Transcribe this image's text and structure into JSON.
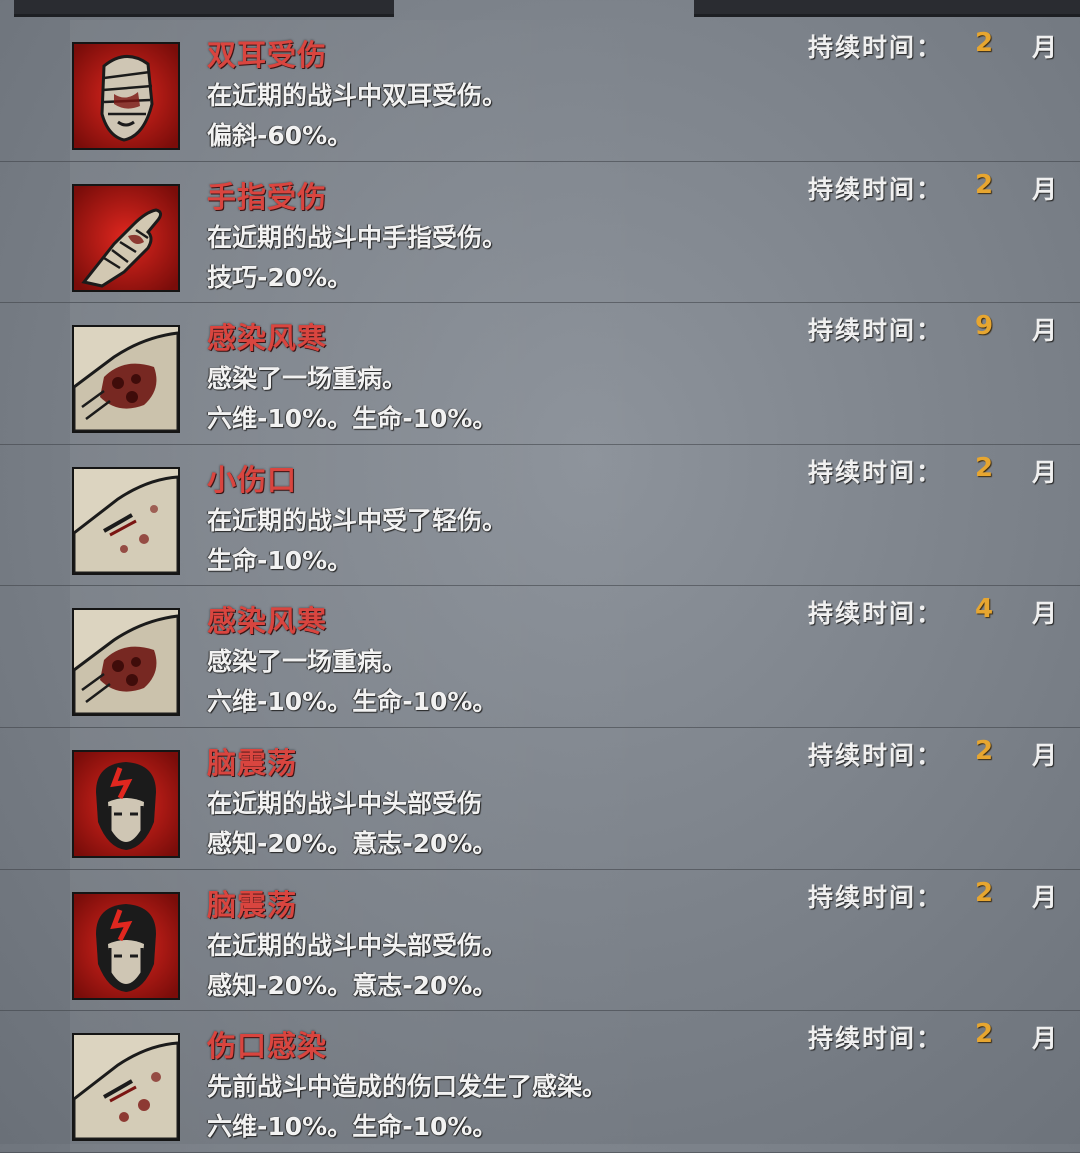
{
  "ailments": [
    {
      "icon": "bandaged-head-icon",
      "name": "双耳受伤",
      "desc": "在近期的战斗中双耳受伤。",
      "effect": "偏斜-60%。",
      "duration_label": "持续时间：",
      "duration_value": "2",
      "duration_unit": "月"
    },
    {
      "icon": "bandaged-hand-icon",
      "name": "手指受伤",
      "desc": "在近期的战斗中手指受伤。",
      "effect": "技巧-20%。",
      "duration_label": "持续时间：",
      "duration_value": "2",
      "duration_unit": "月"
    },
    {
      "icon": "infected-arm-icon",
      "name": "感染风寒",
      "desc": "感染了一场重病。",
      "effect": "六维-10%。生命-10%。",
      "duration_label": "持续时间：",
      "duration_value": "9",
      "duration_unit": "月"
    },
    {
      "icon": "wounded-arm-icon",
      "name": "小伤口",
      "desc": "在近期的战斗中受了轻伤。",
      "effect": "生命-10%。",
      "duration_label": "持续时间：",
      "duration_value": "2",
      "duration_unit": "月"
    },
    {
      "icon": "infected-arm-icon",
      "name": "感染风寒",
      "desc": "感染了一场重病。",
      "effect": "六维-10%。生命-10%。",
      "duration_label": "持续时间：",
      "duration_value": "4",
      "duration_unit": "月"
    },
    {
      "icon": "concussion-head-icon",
      "name": "脑震荡",
      "desc": "在近期的战斗中头部受伤",
      "effect": "感知-20%。意志-20%。",
      "duration_label": "持续时间：",
      "duration_value": "2",
      "duration_unit": "月"
    },
    {
      "icon": "concussion-head-icon",
      "name": "脑震荡",
      "desc": "在近期的战斗中头部受伤。",
      "effect": "感知-20%。意志-20%。",
      "duration_label": "持续时间：",
      "duration_value": "2",
      "duration_unit": "月"
    },
    {
      "icon": "wounded-arm-icon",
      "name": "伤口感染",
      "desc": "先前战斗中造成的伤口发生了感染。",
      "effect": "六维-10%。生命-10%。",
      "duration_label": "持续时间：",
      "duration_value": "2",
      "duration_unit": "月"
    }
  ],
  "colors": {
    "ailment_name": "#d9453f",
    "duration_value": "#e7a630",
    "icon_red": "#b3120f",
    "icon_parchment": "#d9d1bd"
  }
}
